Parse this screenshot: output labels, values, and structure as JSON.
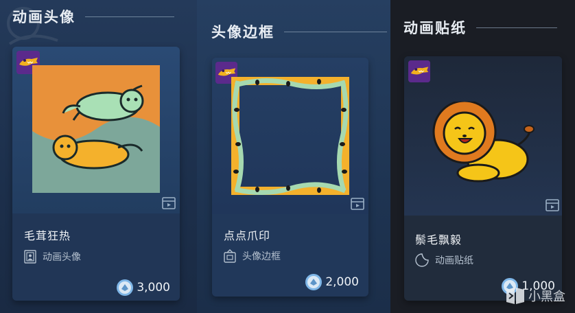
{
  "sections": [
    {
      "title": "动画头像"
    },
    {
      "title": "头像边框"
    },
    {
      "title": "动画贴纸"
    }
  ],
  "items": [
    {
      "name": "毛茸狂热",
      "type": "动画头像",
      "price": "3,000",
      "type_icon": "avatar-frame-icon"
    },
    {
      "name": "点点爪印",
      "type": "头像边框",
      "price": "2,000",
      "type_icon": "frame-icon"
    },
    {
      "name": "鬃毛飘毅",
      "type": "动画贴纸",
      "price": "1,000",
      "type_icon": "sticker-icon"
    }
  ],
  "watermark": "小黑盒",
  "colors": {
    "accent_orange": "#f0a030",
    "accent_green": "#a8dcb0",
    "lion_yellow": "#f5c518",
    "lion_mane": "#e07a1f"
  }
}
